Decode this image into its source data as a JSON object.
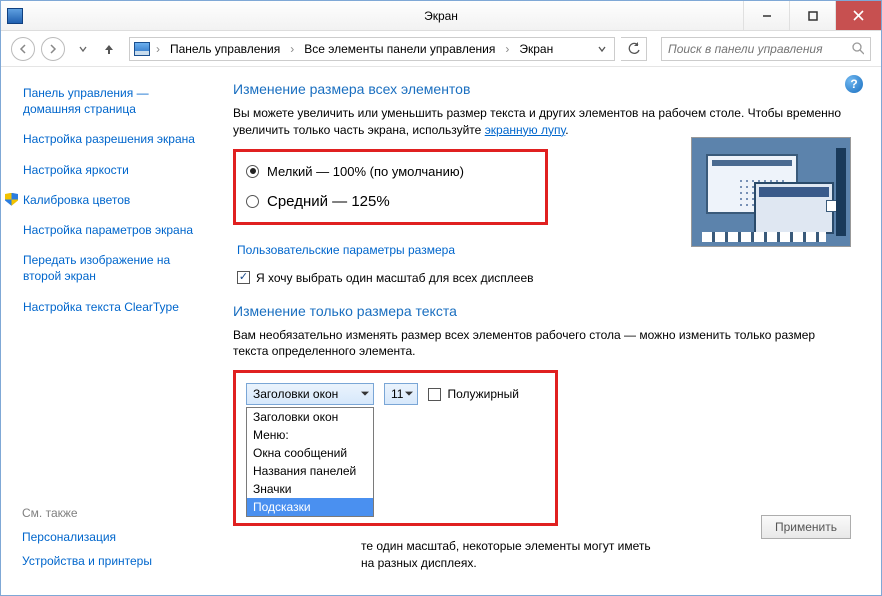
{
  "window": {
    "title": "Экран"
  },
  "winbtns": {
    "min": "—",
    "max": "□",
    "close": "×"
  },
  "breadcrumb": {
    "root": "Панель управления",
    "mid": "Все элементы панели управления",
    "leaf": "Экран"
  },
  "search": {
    "placeholder": "Поиск в панели управления"
  },
  "sidebar": {
    "items": [
      "Панель управления — домашняя страница",
      "Настройка разрешения экрана",
      "Настройка яркости",
      "Калибровка цветов",
      "Настройка параметров экрана",
      "Передать изображение на второй экран",
      "Настройка текста ClearType"
    ],
    "seeAlsoTitle": "См. также",
    "seeAlso": [
      "Персонализация",
      "Устройства и принтеры"
    ]
  },
  "main": {
    "heading1": "Изменение размера всех элементов",
    "desc1a": "Вы можете увеличить или уменьшить размер текста и других элементов на рабочем столе. Чтобы временно увеличить только часть экрана, используйте ",
    "desc1link": "экранную лупу",
    "radio1": "Мелкий — 100% (по умолчанию)",
    "radio2": "Средний — 125%",
    "customLink": "Пользовательские параметры размера",
    "oneScale": "Я хочу выбрать один масштаб для всех дисплеев",
    "heading2": "Изменение только размера текста",
    "desc2": "Вам необязательно изменять размер всех элементов рабочего стола — можно изменить только размер текста определенного элемента.",
    "comboSel": "Заголовки окон",
    "fontSize": "11",
    "bold": "Полужирный",
    "options": [
      "Заголовки окон",
      "Меню:",
      "Окна сообщений",
      "Названия панелей",
      "Значки",
      "Подсказки"
    ],
    "note1": "те один масштаб, некоторые элементы могут иметь",
    "note2": "на разных дисплеях.",
    "apply": "Применить",
    "help": "?"
  }
}
